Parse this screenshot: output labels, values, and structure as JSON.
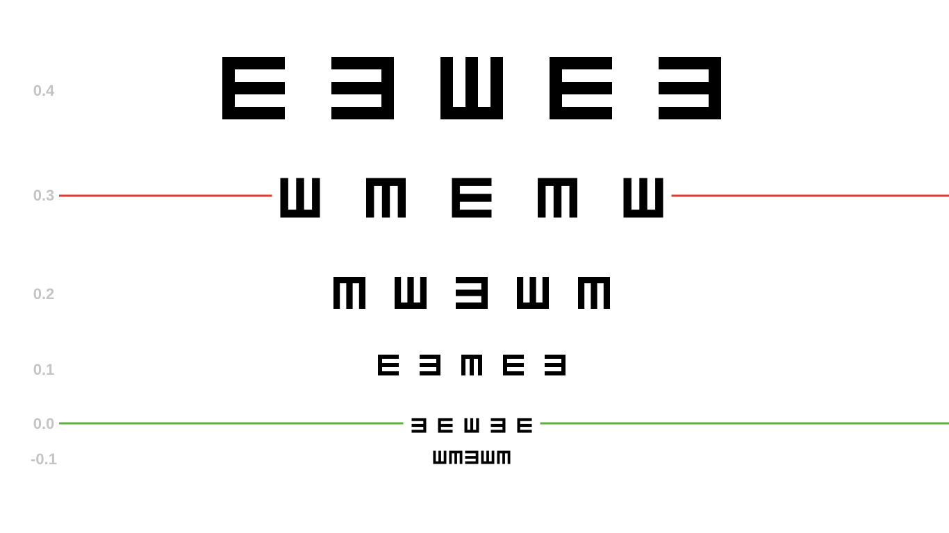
{
  "chart": {
    "rows": [
      {
        "label": "0.4",
        "optotypes": [
          "E",
          "3",
          "W",
          "E",
          "3"
        ]
      },
      {
        "label": "0.3",
        "optotypes": [
          "W",
          "M",
          "E",
          "M",
          "W"
        ]
      },
      {
        "label": "0.2",
        "optotypes": [
          "M",
          "W",
          "3",
          "W",
          "M"
        ]
      },
      {
        "label": "0.1",
        "optotypes": [
          "E",
          "3",
          "M",
          "E",
          "3"
        ]
      },
      {
        "label": "0.0",
        "optotypes": [
          "3",
          "E",
          "W",
          "3",
          "E"
        ]
      },
      {
        "label": "-0.1",
        "optotypes": [
          "W",
          "M",
          "3",
          "W",
          "M"
        ]
      }
    ],
    "reference_lines": [
      {
        "row_label": "0.3",
        "color": "#e03a30"
      },
      {
        "row_label": "0.0",
        "color": "#5cb03e"
      }
    ],
    "optotype_color": "#000000",
    "label_color": "#c4c4c4"
  }
}
